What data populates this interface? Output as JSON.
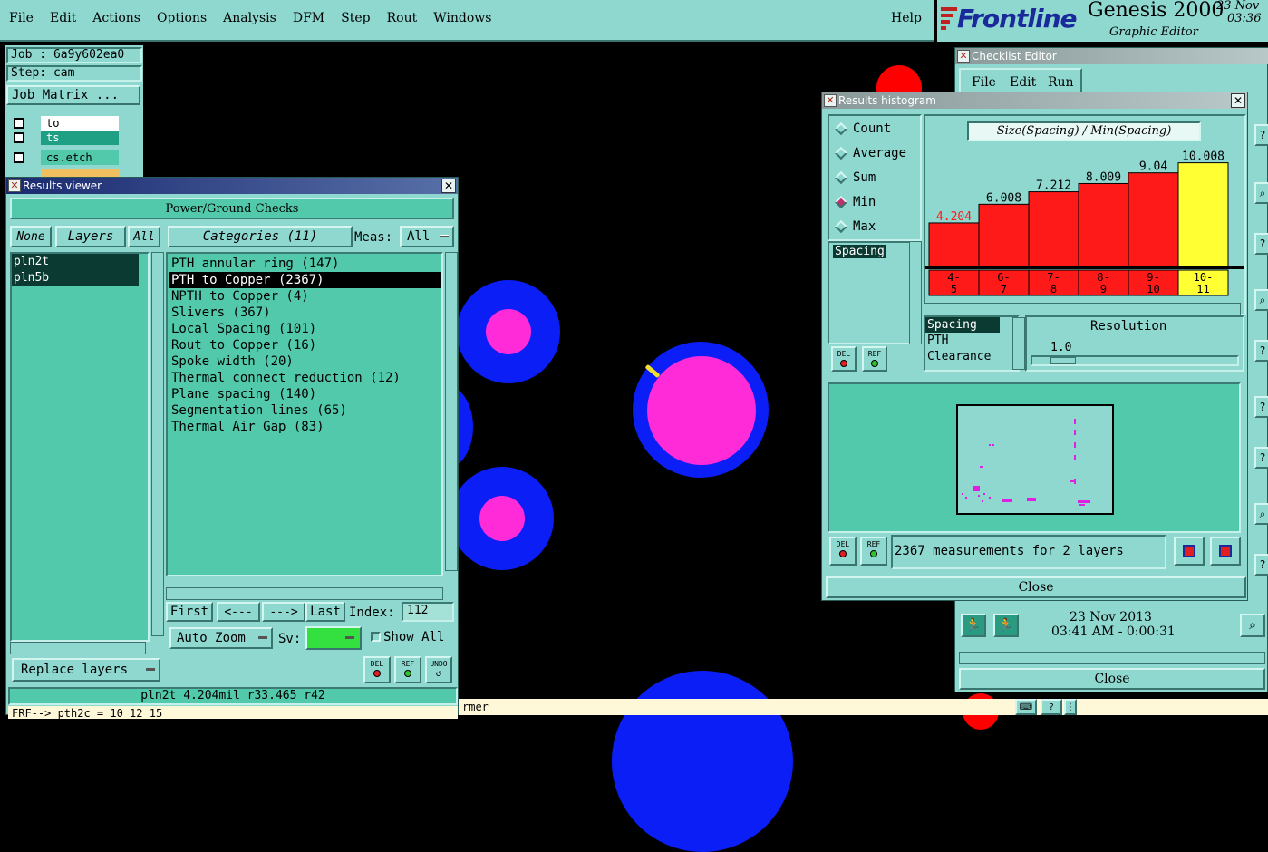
{
  "menubar": {
    "items": [
      "File",
      "Edit",
      "Actions",
      "Options",
      "Analysis",
      "DFM",
      "Step",
      "Rout",
      "Windows"
    ],
    "help": "Help"
  },
  "branding": {
    "logo": "Frontline",
    "product": "Genesis 2000",
    "subtitle": "Graphic Editor",
    "date_top": "23 Nov",
    "time_top": "03:36"
  },
  "job_panel": {
    "job": "Job : 6a9y602ea0",
    "step": "Step: cam",
    "job_matrix": "Job Matrix ...",
    "layers": [
      "to",
      "ts",
      "cs.etch"
    ]
  },
  "results_viewer": {
    "title": "Results viewer",
    "header": "Power/Ground Checks",
    "none_btn": "None",
    "layers_btn": "Layers",
    "all_btn": "All",
    "categories_btn": "Categories (11)",
    "meas_label": "Meas:",
    "meas_value": "All",
    "layer_list": [
      "pln2t",
      "pln5b"
    ],
    "categories": [
      "PTH annular ring (147)",
      "PTH to Copper (2367)",
      "NPTH to Copper (4)",
      "Slivers (367)",
      "Local Spacing (101)",
      "Rout to Copper (16)",
      "Spoke width (20)",
      "Thermal connect reduction (12)",
      "Plane spacing (140)",
      "Segmentation lines (65)",
      "Thermal Air Gap (83)"
    ],
    "selected_category_index": 1,
    "first_btn": "First",
    "prev_btn": "<---",
    "next_btn": "--->",
    "last_btn": "Last",
    "index_label": "Index:",
    "index_value": "112",
    "auto_zoom": "Auto Zoom",
    "sv_label": "Sv:",
    "show_all": "Show All",
    "replace_layers": "Replace layers",
    "del": "DEL",
    "ref": "REF",
    "undo": "UNDO",
    "status": "pln2t 4.204mil  r33.465  r42",
    "command": "FRF--> pth2c = 10 12 15"
  },
  "histogram": {
    "title": "Results histogram",
    "modes": [
      "Count",
      "Average",
      "Sum",
      "Min",
      "Max"
    ],
    "selected_mode": "Min",
    "chart_title": "Size(Spacing) / Min(Spacing)",
    "list_item": "Spacing",
    "resolution_label": "Resolution",
    "resolution_value": "1.0",
    "attr_list": [
      "Spacing",
      "PTH",
      "Clearance"
    ],
    "del": "DEL",
    "ref": "REF",
    "measurements": "2367 measurements for 2 layers",
    "close": "Close",
    "colors": {
      "bar": "#ff1a1a",
      "highlight": "#ffff33",
      "label_red": "#ff1a1a"
    }
  },
  "chart_data": {
    "type": "bar",
    "title": "Size(Spacing) / Min(Spacing)",
    "categories": [
      "4-5",
      "6-7",
      "7-8",
      "8-9",
      "9-10",
      "10-11"
    ],
    "values": [
      4.204,
      6.008,
      7.212,
      8.009,
      9.04,
      10.008
    ],
    "value_labels": [
      "4.204",
      "6.008",
      "7.212",
      "8.009",
      "9.04",
      "10.008"
    ],
    "highlight_index": 5,
    "ylim": [
      0,
      10.5
    ],
    "grid": false
  },
  "checklist_editor": {
    "title": "Checklist Editor",
    "menu": [
      "File",
      "Edit",
      "Run"
    ],
    "date": "23 Nov 2013",
    "time": "03:41 AM - 0:00:31",
    "close": "Close"
  },
  "bottom_bar": {
    "text": "rmer"
  }
}
